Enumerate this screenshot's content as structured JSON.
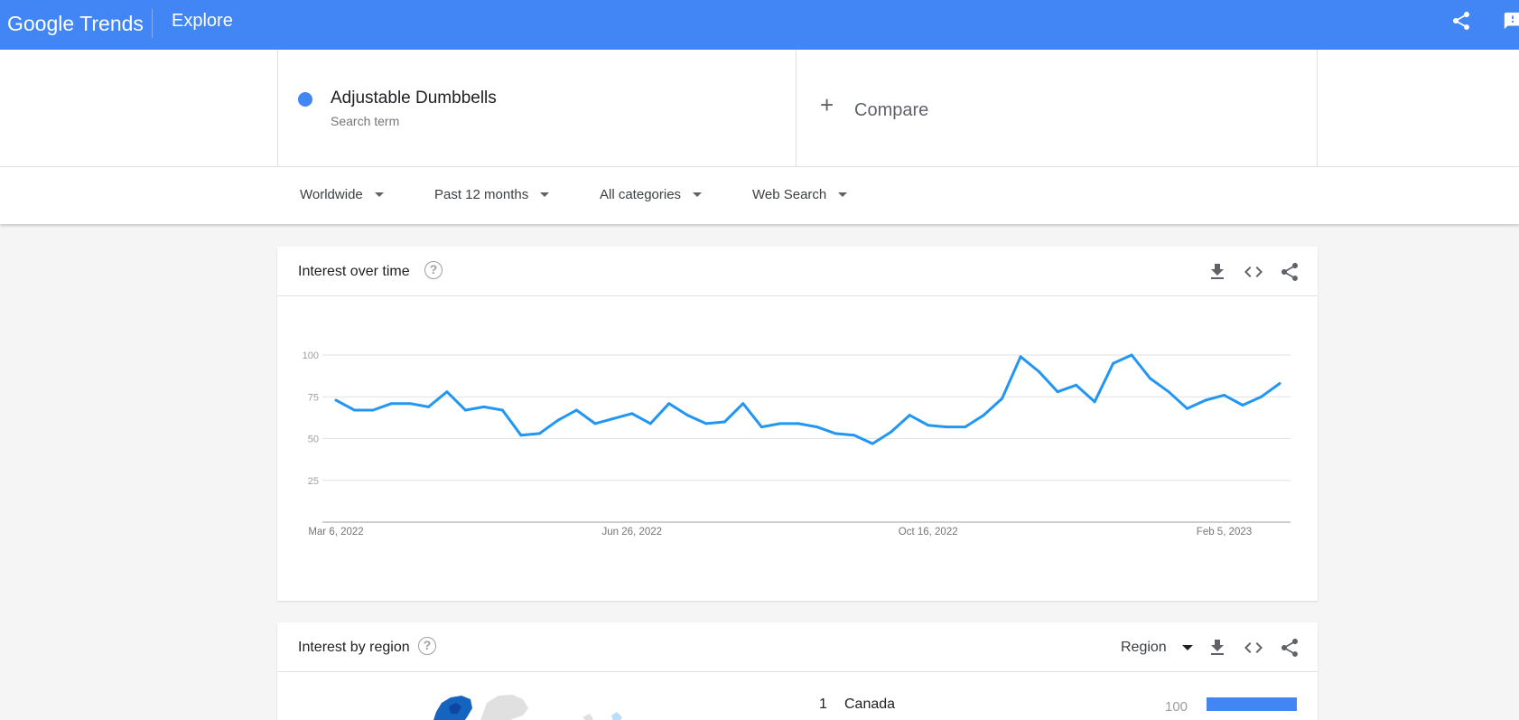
{
  "header": {
    "logo_google": "Google",
    "logo_trends": "Trends",
    "section_title": "Explore"
  },
  "search_term": {
    "label": "Adjustable Dumbbells",
    "type": "Search term",
    "color": "#4285f4"
  },
  "compare": {
    "label": "Compare"
  },
  "filters": {
    "location": "Worldwide",
    "time_range": "Past 12 months",
    "category": "All categories",
    "search_type": "Web Search"
  },
  "interest_over_time": {
    "title": "Interest over time",
    "help_label": "?"
  },
  "chart_data": {
    "type": "line",
    "title": "Interest over time",
    "xlabel": "",
    "ylabel": "",
    "ylim": [
      0,
      100
    ],
    "yticks": [
      "100",
      "75",
      "50",
      "25"
    ],
    "x_tick_labels": [
      "Mar 6, 2022",
      "Jun 26, 2022",
      "Oct 16, 2022",
      "Feb 5, 2023"
    ],
    "series": [
      {
        "color": "#2196f3",
        "values": [
          73,
          67,
          67,
          71,
          71,
          69,
          78,
          67,
          69,
          67,
          52,
          53,
          61,
          67,
          59,
          62,
          65,
          59,
          71,
          64,
          59,
          60,
          71,
          57,
          59,
          59,
          57,
          53,
          52,
          47,
          54,
          64,
          58,
          57,
          57,
          64,
          74,
          99,
          90,
          78,
          82,
          72,
          95,
          100,
          86,
          78,
          68,
          73,
          76,
          70,
          75,
          83
        ]
      }
    ],
    "grid": true,
    "legend": "none"
  },
  "interest_by_region": {
    "title": "Interest by region",
    "help_label": "?",
    "resolution": "Region",
    "rows": [
      {
        "rank": "1",
        "name": "Canada",
        "value": "100",
        "fraction": 1.0
      }
    ]
  },
  "icons": {
    "share": "share-icon",
    "feedback": "feedback-icon",
    "download": "download-icon",
    "embed": "embed-code-icon",
    "card_share": "share-icon"
  }
}
